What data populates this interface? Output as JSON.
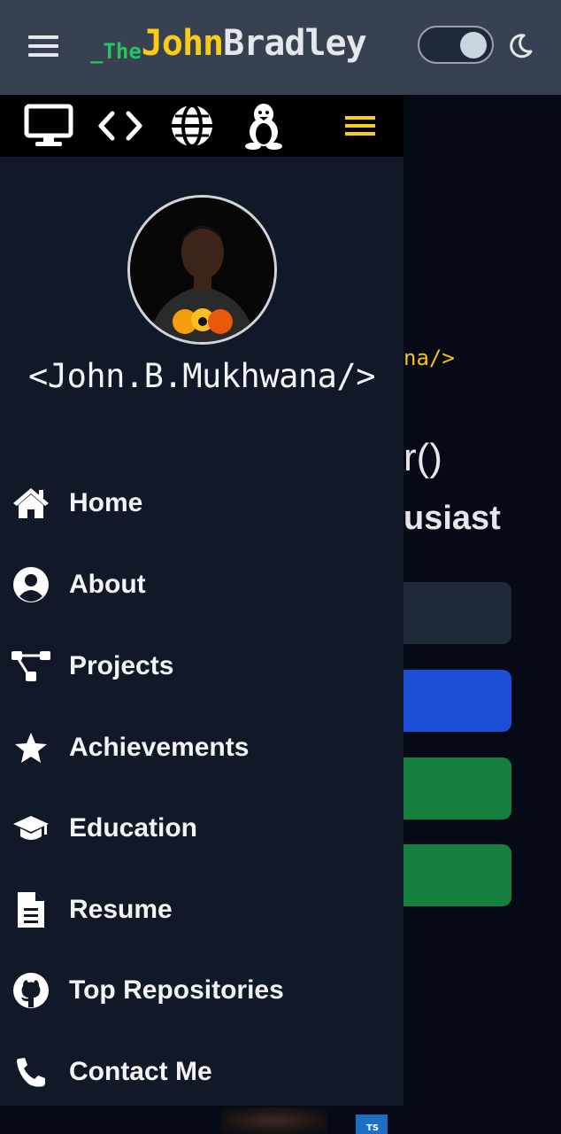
{
  "header": {
    "brand_prefix": "_The",
    "brand_first": "John",
    "brand_last": "Bradley"
  },
  "background": {
    "code_tag": "na/>",
    "function_fragment": "r()",
    "role_fragment": "usiast",
    "badge_text": "TS"
  },
  "drawer": {
    "name": "<John.B.Mukhwana/>",
    "nav": [
      {
        "label": "Home",
        "icon": "home-icon"
      },
      {
        "label": "About",
        "icon": "user-circle-icon"
      },
      {
        "label": "Projects",
        "icon": "project-diagram-icon"
      },
      {
        "label": "Achievements",
        "icon": "star-icon"
      },
      {
        "label": "Education",
        "icon": "graduation-cap-icon"
      },
      {
        "label": "Resume",
        "icon": "file-icon"
      },
      {
        "label": "Top Repositories",
        "icon": "github-icon"
      },
      {
        "label": "Contact Me",
        "icon": "phone-icon"
      }
    ]
  },
  "colors": {
    "header_bg": "#374151",
    "drawer_bg": "#111827",
    "brand_green": "#22c55e",
    "brand_yellow": "#facc15",
    "accent_yellow": "#fbbf24"
  }
}
